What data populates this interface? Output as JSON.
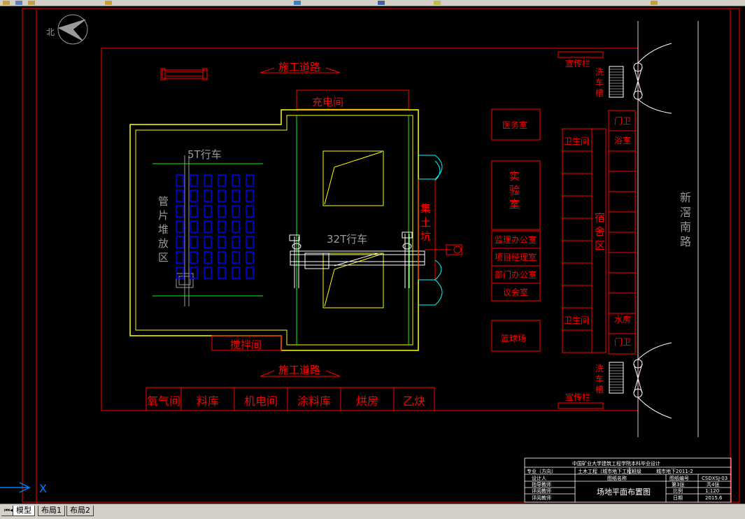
{
  "colors": {
    "bg": "#000000",
    "red": "#ff0000",
    "yellow": "#ffff00",
    "green": "#00ff00",
    "blue": "#0000ff",
    "cyan": "#00ffff",
    "white": "#ffffff",
    "gray": "#9a9a9a"
  },
  "north": "北",
  "road_top": "施工道路",
  "road_bottom": "施工道路",
  "charging_room": "充电间",
  "crane_5t": "5T行车",
  "crane_32t": "32T行车",
  "pipe_area": [
    "管",
    "片",
    "堆",
    "放",
    "区"
  ],
  "sump": [
    "集",
    "土",
    "坑"
  ],
  "mixing_room": "搅拌间",
  "bottom_rooms": [
    "氧气间",
    "料库",
    "机电间",
    "涂料库",
    "烘房",
    "乙炔"
  ],
  "medical_room": "医务室",
  "lab": [
    "实",
    "验",
    "室"
  ],
  "offices": [
    "监理办公室",
    "项目经理室",
    "部门办公室",
    "议会室"
  ],
  "basketball": "篮球场",
  "toilet_top": "卫生间",
  "toilet_bottom": "卫生间",
  "dormitory": [
    "宿",
    "舍",
    "区"
  ],
  "gate_top": "门卫",
  "gate_bottom": "门卫",
  "bathroom": "浴室",
  "water_room": "水房",
  "board_top": "宣传栏",
  "board_bottom": "宣传栏",
  "wash_top": [
    "洗",
    "车",
    "槽"
  ],
  "wash_bottom": [
    "洗",
    "车",
    "槽"
  ],
  "road_right": [
    "新",
    "滘",
    "南",
    "路"
  ],
  "title_block": {
    "header": "中国矿业大学建筑工程学院本科毕业设计",
    "major_label": "专业（方向）",
    "major_value": "土木工程（城市地下工程）",
    "class_label": "班级",
    "class_value": "城市地下2011-2",
    "designer": "设计人",
    "advisor": "指导教师",
    "reviewer1": "评阅教师",
    "reviewer2": "评阅教师",
    "drawing_name_label": "图纸名称",
    "drawing_name": "场地平面布置图",
    "drawing_no_label": "图纸编号",
    "drawing_no": "CSDXSJ-03",
    "sheet": "第3张",
    "total": "共4张",
    "scale_label": "比例",
    "scale": "1:120",
    "date_label": "日期",
    "date": "2015.6"
  },
  "ucs_x": "X",
  "tabs": [
    "模型",
    "布局1",
    "布局2"
  ]
}
